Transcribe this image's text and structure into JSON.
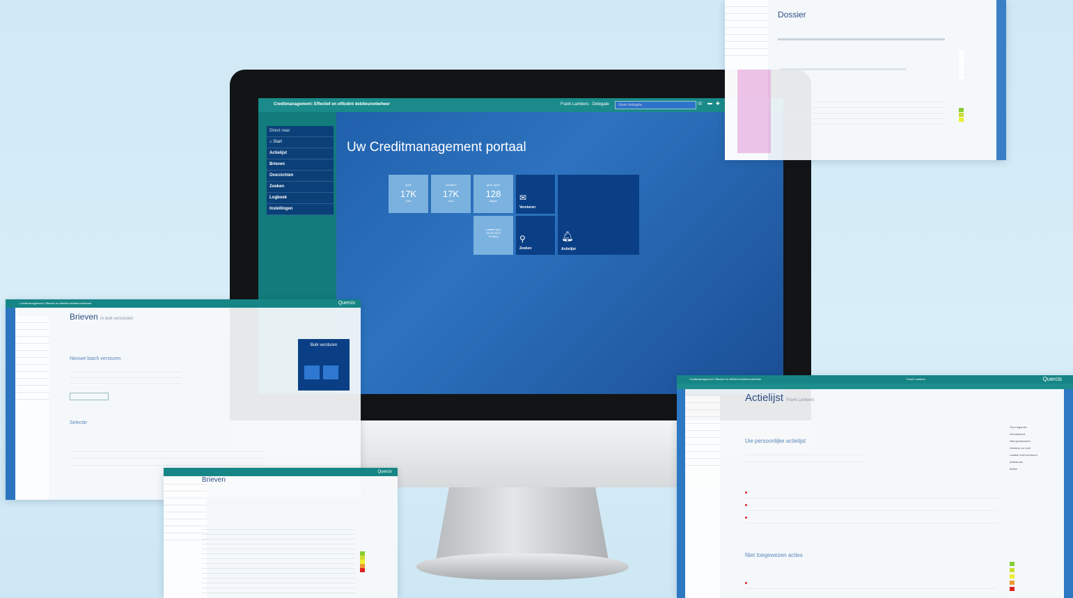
{
  "brand": "Quercis",
  "main": {
    "app_title": "Creditmanagement: Effectief en efficiënt debiteurenbeheer",
    "user": "Frank Lambers",
    "delegate_label": "Delegate",
    "delegate_placeholder": "-Geen delegate-",
    "nav_header": "Direct naar",
    "nav_items": [
      "Start",
      "Actielijst",
      "Brieven",
      "Overzichten",
      "Zoeken",
      "Logboek",
      "Instellingen"
    ],
    "portal_title": "Uw Creditmanagement portaal",
    "tiles": [
      {
        "label": "open",
        "value": "17K",
        "unit": "euro"
      },
      {
        "label": "vervallen",
        "value": "17K",
        "unit": "euro"
      },
      {
        "label": "gem. open",
        "value": "128",
        "unit": "dagen"
      },
      {
        "label": "Laatste sync",
        "value": "08-09-2023",
        "unit": "13:18uu"
      }
    ],
    "actions": [
      "Versturen",
      "Zoeken",
      "Actielijst"
    ]
  },
  "brieven": {
    "title": "Brieven",
    "subtitle": "In bulk verzenden",
    "batch_title": "Nieuwe batch versturen",
    "bulk_button": "Bulk versturen",
    "selectie": "Selectie"
  },
  "actielijst": {
    "title": "Actielijst",
    "subtitle": "Frank Lambers",
    "personal": "Uw persoonlijke actielijst",
    "unassigned": "Niet toegewezen acties",
    "right_panel": [
      "Toon legenda",
      "Gemarkeerd",
      "Niet gemarkeerd",
      "Dekkese on hold",
      "Laatste brief verstuurd",
      "Aktiebreak",
      "Bellen"
    ]
  },
  "dossier": {
    "title": "Dossier"
  },
  "brieven2": {
    "title": "Brieven"
  }
}
